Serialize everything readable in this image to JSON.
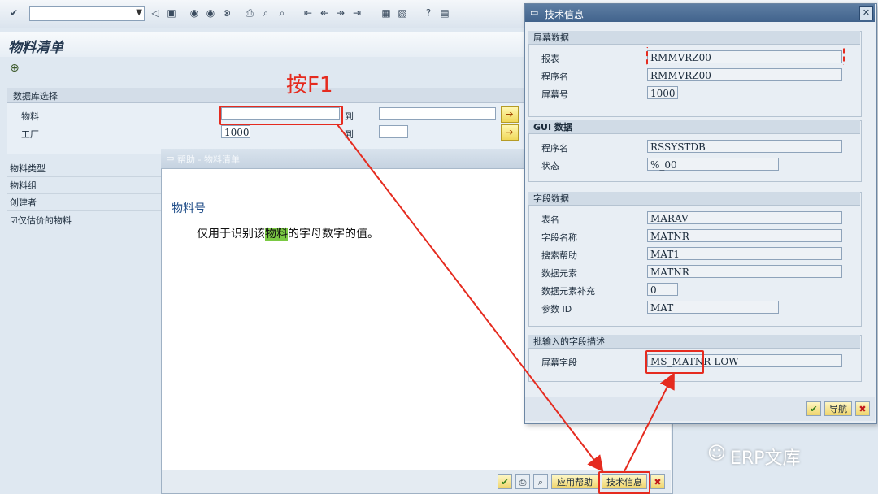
{
  "toolbar": {
    "icons": [
      "check-icon",
      "dropdown",
      "back",
      "save",
      "back-nav",
      "exit",
      "cancel",
      "print",
      "find",
      "find-next",
      "first-page",
      "prev-page",
      "next-page",
      "last-page",
      "layout",
      "layout2",
      "help",
      "customize"
    ]
  },
  "main": {
    "title": "物料清单",
    "selection": {
      "header": "数据库选择",
      "rows": [
        {
          "label": "物料",
          "from": "",
          "to_label": "到",
          "to": ""
        },
        {
          "label": "工厂",
          "from": "1000",
          "to_label": "到",
          "to": ""
        }
      ]
    },
    "side_rows": [
      "物料类型",
      "物料组",
      "创建者"
    ],
    "checkbox": {
      "label": "仅估价的物料",
      "checked": true
    }
  },
  "help_dialog": {
    "title": "帮助 - 物料清单",
    "heading": "物料号",
    "text_before": "仅用于识别该",
    "text_highlight": "物料",
    "text_after": "的字母数字的值。",
    "buttons": {
      "app_help": "应用帮助",
      "tech_info": "技术信息"
    }
  },
  "tech_dialog": {
    "title": "技术信息",
    "screen_data": {
      "header": "屏幕数据",
      "rows": [
        {
          "label": "报表",
          "value": "RMMVRZ00"
        },
        {
          "label": "程序名",
          "value": "RMMVRZ00"
        },
        {
          "label": "屏幕号",
          "value": "1000"
        }
      ]
    },
    "gui_data": {
      "header": "GUI 数据",
      "rows": [
        {
          "label": "程序名",
          "value": "RSSYSTDB"
        },
        {
          "label": "状态",
          "value": "%_00"
        }
      ]
    },
    "field_data": {
      "header": "字段数据",
      "rows": [
        {
          "label": "表名",
          "value": "MARAV"
        },
        {
          "label": "字段名称",
          "value": "MATNR"
        },
        {
          "label": "搜索帮助",
          "value": "MAT1"
        },
        {
          "label": "数据元素",
          "value": "MATNR"
        },
        {
          "label": "数据元素补充",
          "value": "0"
        },
        {
          "label": "参数 ID",
          "value": "MAT"
        }
      ]
    },
    "batch_input": {
      "header": "批输入的字段描述",
      "rows": [
        {
          "label": "屏幕字段",
          "value": "MS_MATNR-LOW"
        }
      ]
    },
    "buttons": {
      "nav": "导航"
    }
  },
  "annotation": {
    "text": "按F1"
  },
  "watermark": {
    "text": "ERP文库"
  },
  "colors": {
    "annotation_red": "#e52b1f",
    "title_blue": "#41638c"
  }
}
